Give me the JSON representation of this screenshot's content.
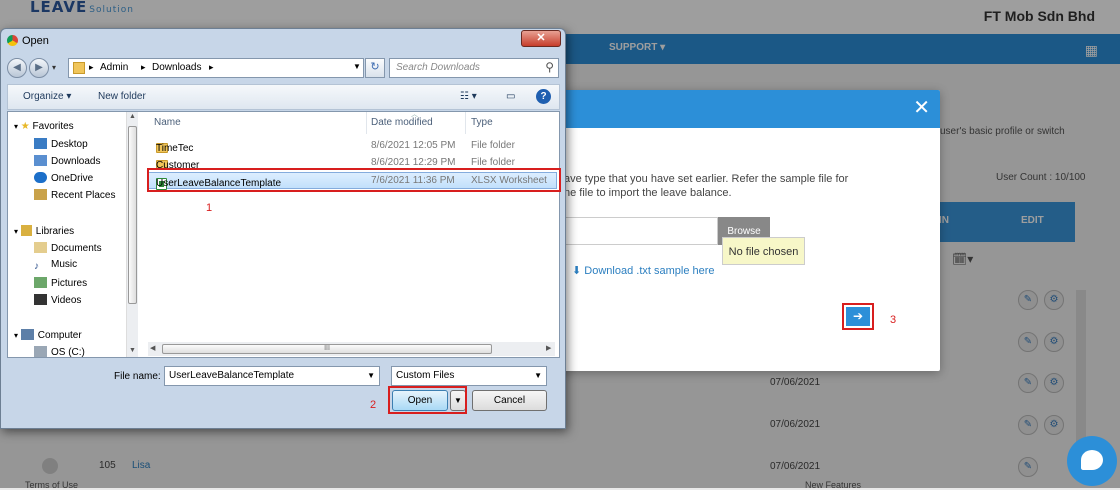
{
  "background": {
    "logo": "LEAVE",
    "logo_sub": "Solution",
    "company": "FT Mob Sdn Bhd",
    "nav_support": "SUPPORT",
    "hint": "user's basic profile or switch",
    "user_count": "User Count : 10/100",
    "table_col_in": "N IN",
    "table_col_edit": "EDIT",
    "dates": [
      "07/06/2021",
      "07/06/2021",
      "07/06/2021"
    ],
    "row_id": "105",
    "row_name": "Lisa",
    "footer_left": "Terms of Use",
    "footer_right": "New Features"
  },
  "modal": {
    "description": "ave type that you have set earlier. Refer the sample file for\nne file to import the leave balance.",
    "browse_label": "Browse",
    "tooltip": "No file chosen",
    "sample_link": "Download .txt sample here"
  },
  "annotations": {
    "step1": "1",
    "step2": "2",
    "step3": "3"
  },
  "dialog": {
    "title": "Open",
    "path": [
      "Admin",
      "Downloads"
    ],
    "search_placeholder": "Search Downloads",
    "organize_label": "Organize",
    "new_folder_label": "New folder",
    "sidebar": {
      "favorites": "Favorites",
      "fav_items": [
        "Desktop",
        "Downloads",
        "OneDrive",
        "Recent Places"
      ],
      "libraries": "Libraries",
      "lib_items": [
        "Documents",
        "Music",
        "Pictures",
        "Videos"
      ],
      "computer": "Computer",
      "drive": "OS (C:)"
    },
    "columns": {
      "name": "Name",
      "date": "Date modified",
      "type": "Type"
    },
    "files": [
      {
        "name": "TimeTec",
        "date": "8/6/2021 12:05 PM",
        "type": "File folder"
      },
      {
        "name": "Customer",
        "date": "8/6/2021 12:29 PM",
        "type": "File folder"
      },
      {
        "name": "UserLeaveBalanceTemplate",
        "date": "7/6/2021 11:36 PM",
        "type": "XLSX Worksheet"
      }
    ],
    "filename_label": "File name:",
    "filename_value": "UserLeaveBalanceTemplate",
    "filter_value": "Custom Files",
    "open_label": "Open",
    "cancel_label": "Cancel"
  }
}
